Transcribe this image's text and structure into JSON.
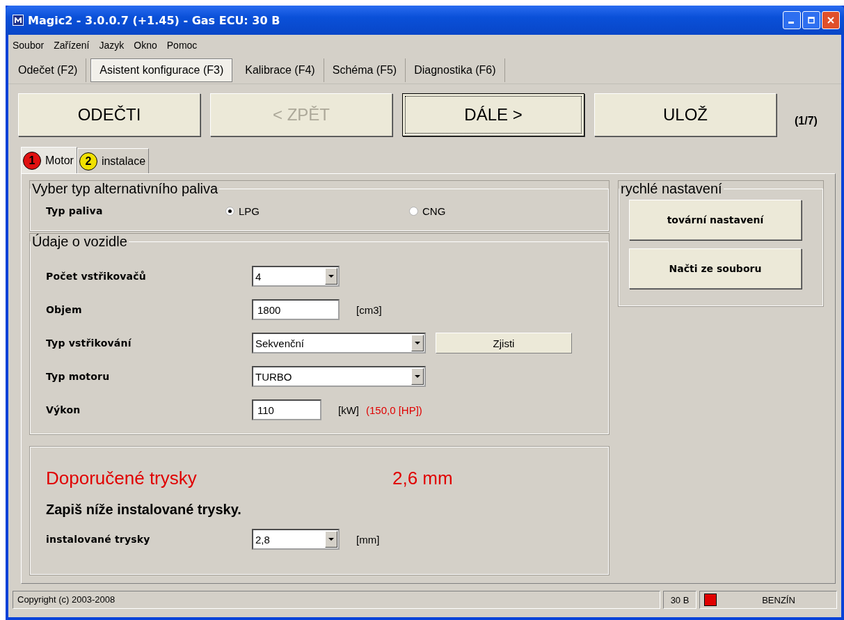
{
  "window": {
    "title": "Magic2 - 3.0.0.7 (+1.45) - Gas ECU: 30 B"
  },
  "menu": [
    "Soubor",
    "Zařízení",
    "Jazyk",
    "Okno",
    "Pomoc"
  ],
  "tabs": [
    {
      "label": "Odečet (F2)",
      "selected": false
    },
    {
      "label": "Asistent konfigurace (F3)",
      "selected": true
    },
    {
      "label": "Kalibrace (F4)",
      "selected": false
    },
    {
      "label": "Schéma (F5)",
      "selected": false
    },
    {
      "label": "Diagnostika (F6)",
      "selected": false
    }
  ],
  "actions": [
    {
      "label": "ODEČTI",
      "disabled": false,
      "focused": false
    },
    {
      "label": "< ZPĚT",
      "disabled": true,
      "focused": false
    },
    {
      "label": "DÁLE >",
      "disabled": false,
      "focused": true
    },
    {
      "label": "ULOŽ",
      "disabled": false,
      "focused": false
    }
  ],
  "step": "(1/7)",
  "subtabs": [
    {
      "number": "1",
      "label": "Motor",
      "color": "#e01010",
      "selected": true
    },
    {
      "number": "2",
      "label": "instalace",
      "color": "#f0e000",
      "selected": false
    }
  ],
  "fuel": {
    "title": "Vyber typ alternativního paliva",
    "label": "Typ paliva",
    "options": [
      {
        "label": "LPG",
        "selected": true
      },
      {
        "label": "CNG",
        "selected": false
      }
    ]
  },
  "vehicle": {
    "title": "Údaje o vozidle",
    "rows": [
      {
        "kind": "dropdown",
        "label": "Počet vstřikovačů",
        "value": "4"
      },
      {
        "kind": "input",
        "label": "Objem",
        "value": "1800",
        "unit": "[cm3]"
      },
      {
        "kind": "dropdown",
        "label": "Typ vstřikování",
        "value": "Sekvenční",
        "button": "Zjisti"
      },
      {
        "kind": "dropdown",
        "label": "Typ motoru",
        "value": "TURBO"
      },
      {
        "kind": "input",
        "label": "Výkon",
        "value": "110",
        "unit": "[kW]",
        "note": "(150,0 [HP])"
      }
    ]
  },
  "recommendation": {
    "label": "Doporučené trysky",
    "value": "2,6 mm",
    "instruction": "Zapiš níže instalované trysky.",
    "field_label": "instalované trysky",
    "field_value": "2,8",
    "unit": "[mm]"
  },
  "quick": {
    "title": "rychlé nastavení",
    "buttons": [
      "tovární nastavení",
      "Načti ze souboru"
    ]
  },
  "status_bar": {
    "copyright": "Copyright (c) 2003-2008",
    "ecu": "30 B",
    "mode": "BENZÍN"
  }
}
